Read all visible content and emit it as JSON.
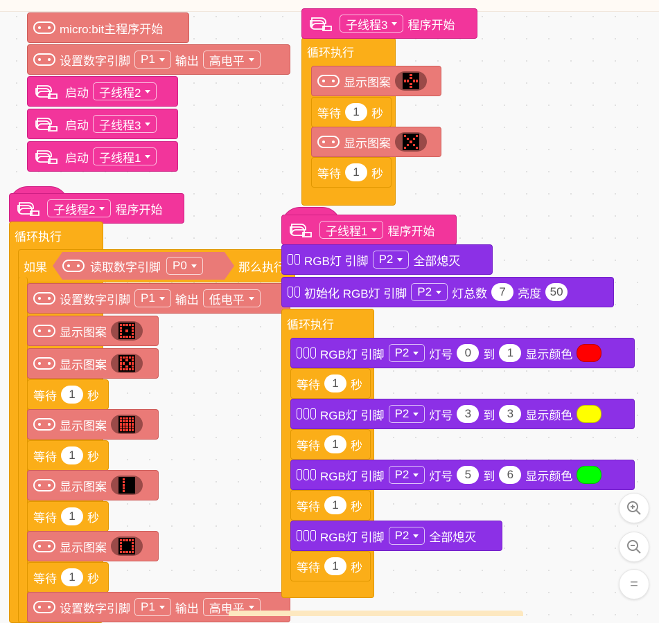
{
  "main_program": {
    "start_label": "micro:bit主程序开始",
    "set_pin_label": "设置数字引脚",
    "set_pin_pin": "P1",
    "output_label": "输出",
    "output_level_high": "高电平",
    "start_thread_label": "启动",
    "start_threads": [
      "子线程2",
      "子线程3",
      "子线程1"
    ]
  },
  "thread3": {
    "name": "子线程3",
    "start_suffix": "程序开始",
    "loop_label": "循环执行",
    "show_pattern_label": "显示图案",
    "wait_label": "等待",
    "wait_value": "1",
    "sec_label": "秒"
  },
  "thread2": {
    "name": "子线程2",
    "start_suffix": "程序开始",
    "loop_label": "循环执行",
    "if_label": "如果",
    "read_pin_label": "读取数字引脚",
    "read_pin_pin": "P0",
    "then_label": "那么执行",
    "set_pin_label": "设置数字引脚",
    "set_pin_pin": "P1",
    "output_label": "输出",
    "level_low": "低电平",
    "level_high": "高电平",
    "show_pattern_label": "显示图案",
    "wait_label": "等待",
    "wait_value": "1",
    "sec_label": "秒"
  },
  "thread1": {
    "name": "子线程1",
    "start_suffix": "程序开始",
    "rgb_label": "RGB灯 引脚",
    "pin": "P2",
    "all_off_label": "全部熄灭",
    "init_label": "初始化 RGB灯 引脚",
    "total_label": "灯总数",
    "total_value": "7",
    "brightness_label": "亮度",
    "brightness_value": "50",
    "loop_label": "循环执行",
    "lamp_label": "灯号",
    "to_label": "到",
    "show_color_label": "显示颜色",
    "ranges": [
      {
        "from": "0",
        "to": "1",
        "color": "#ff0000"
      },
      {
        "from": "3",
        "to": "3",
        "color": "#ffff00"
      },
      {
        "from": "5",
        "to": "6",
        "color": "#00ff00"
      }
    ],
    "wait_label": "等待",
    "wait_value": "1",
    "sec_label": "秒"
  },
  "zoom": {
    "zoom_in": "+",
    "zoom_out": "−",
    "reset": "="
  },
  "colors": {
    "pink": "#f2359b",
    "salmon": "#ea7a77",
    "orange": "#fbae18",
    "purple": "#8c30e6"
  }
}
